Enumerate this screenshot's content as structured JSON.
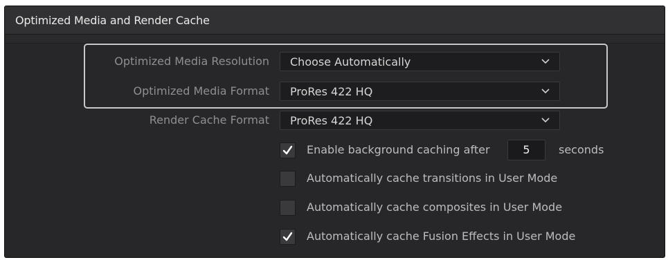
{
  "panel": {
    "title": "Optimized Media and Render Cache"
  },
  "settings": {
    "optimized_media_resolution": {
      "label": "Optimized Media Resolution",
      "value": "Choose Automatically"
    },
    "optimized_media_format": {
      "label": "Optimized Media Format",
      "value": "ProRes 422 HQ"
    },
    "render_cache_format": {
      "label": "Render Cache Format",
      "value": "ProRes 422 HQ"
    }
  },
  "options": {
    "background_caching": {
      "label": "Enable background caching after",
      "checked": true,
      "seconds_value": "5",
      "seconds_label": "seconds"
    },
    "cache_transitions": {
      "label": "Automatically cache transitions in User Mode",
      "checked": false
    },
    "cache_composites": {
      "label": "Automatically cache composites in User Mode",
      "checked": false
    },
    "cache_fusion": {
      "label": "Automatically cache Fusion Effects in User Mode",
      "checked": true
    }
  },
  "icons": {
    "dropdown": "chevron-down-icon",
    "check": "checkmark-icon"
  },
  "colors": {
    "panel_bg": "#2a2a2c",
    "highlight_border": "#c9c9c9",
    "label_text": "#8f8f92"
  }
}
